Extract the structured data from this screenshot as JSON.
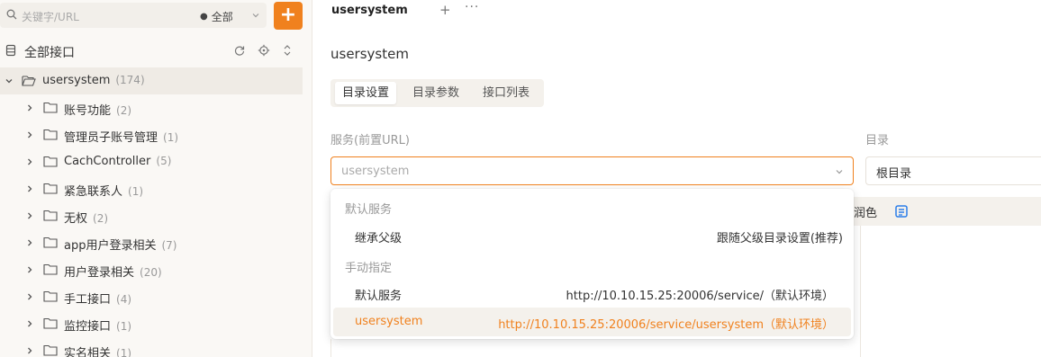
{
  "search": {
    "placeholder": "关键字/URL",
    "scope": "全部",
    "add_label": "+"
  },
  "all_api": {
    "label": "全部接口"
  },
  "tree": {
    "root": {
      "label": "usersystem",
      "count": "(174)"
    },
    "items": [
      {
        "label": "账号功能",
        "count": "(2)"
      },
      {
        "label": "管理员子账号管理",
        "count": "(1)"
      },
      {
        "label": "CachController",
        "count": "(5)"
      },
      {
        "label": "紧急联系人",
        "count": "(1)"
      },
      {
        "label": "无权",
        "count": "(2)"
      },
      {
        "label": "app用户登录相关",
        "count": "(7)"
      },
      {
        "label": "用户登录相关",
        "count": "(20)"
      },
      {
        "label": "手工接口",
        "count": "(4)"
      },
      {
        "label": "监控接口",
        "count": "(1)"
      },
      {
        "label": "实名相关",
        "count": "(1)"
      }
    ]
  },
  "tabs": {
    "active": "usersystem",
    "plus": "+",
    "more": "···"
  },
  "page": {
    "title": "usersystem"
  },
  "segments": [
    "目录设置",
    "目录参数",
    "接口列表"
  ],
  "form": {
    "service_label": "服务(前置URL)",
    "service_value": "usersystem",
    "dir_label": "目录",
    "dir_value": "根目录",
    "polish_label": "润色"
  },
  "dropdown": {
    "group_default": "默认服务",
    "inherit": {
      "name": "继承父级",
      "desc": "跟随父级目录设置(推荐)"
    },
    "group_manual": "手动指定",
    "default_service": {
      "name": "默认服务",
      "url": "http://10.10.15.25:20006/service/（默认环境）"
    },
    "usersystem": {
      "name": "usersystem",
      "url": "http://10.10.15.25:20006/service/usersystem（默认环境）"
    }
  },
  "colors": {
    "accent": "#f0811e",
    "link_icon": "#2b7de9"
  }
}
